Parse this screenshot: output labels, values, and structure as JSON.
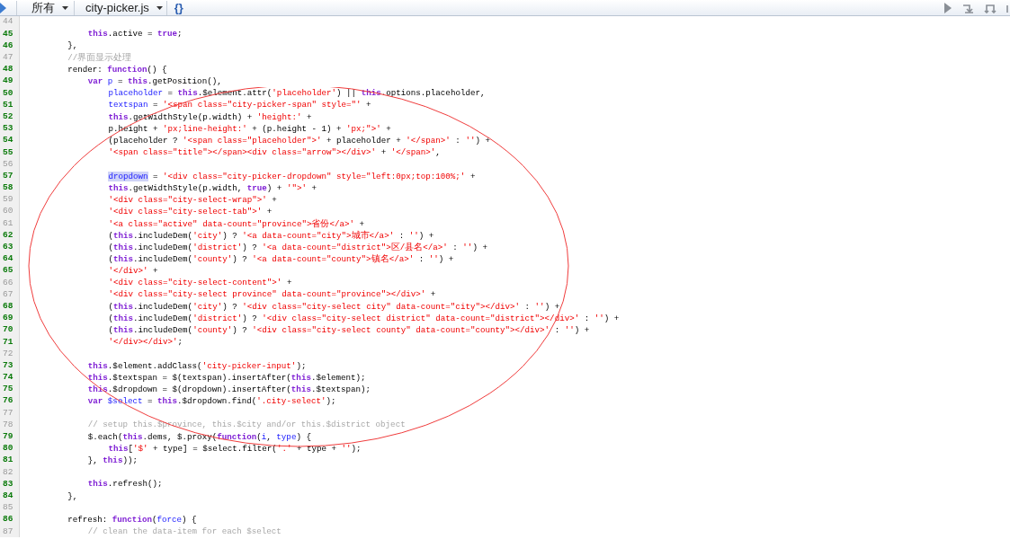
{
  "toolbar": {
    "scope": "所有",
    "file": "city-picker.js",
    "format_button": "{}"
  },
  "lines": [
    {
      "number": "44",
      "highlighted": false,
      "children": [
        {
          "number": "45",
          "highlighted": true,
          "tokens": [
            {
              "kind": "keyword",
              "text": "this"
            },
            {
              "kind": "plain",
              "text": ".active = "
            },
            {
              "kind": "keyword",
              "text": "true"
            },
            {
              "kind": "plain",
              "text": ";"
            }
          ]
        }
      ]
    },
    {
      "number": "46",
      "highlighted": true,
      "tokens": [
        {
          "kind": "plain",
          "text": "},"
        }
      ]
    },
    {
      "number": "47",
      "highlighted": false,
      "tokens": [
        {
          "kind": "comment",
          "text": "//界面显示处理"
        }
      ]
    },
    {
      "number": "48",
      "highlighted": true,
      "tokens": [
        {
          "kind": "plain",
          "text": "render: "
        },
        {
          "kind": "keyword",
          "text": "function"
        },
        {
          "kind": "plain",
          "text": "() {"
        }
      ],
      "children": [
        {
          "number": "49",
          "highlighted": true,
          "tokens": [
            {
              "kind": "keyword",
              "text": "var "
            },
            {
              "kind": "variable",
              "text": "p"
            },
            {
              "kind": "plain",
              "text": " = "
            },
            {
              "kind": "keyword",
              "text": "this"
            },
            {
              "kind": "plain",
              "text": ".getPosition(),"
            }
          ],
          "children": [
            {
              "number": "50",
              "highlighted": true,
              "tokens": [
                {
                  "kind": "variable",
                  "text": "placeholder"
                },
                {
                  "kind": "plain",
                  "text": " = "
                },
                {
                  "kind": "keyword",
                  "text": "this"
                },
                {
                  "kind": "plain",
                  "text": ".$element.attr("
                },
                {
                  "kind": "string",
                  "text": "'placeholder'"
                },
                {
                  "kind": "plain",
                  "text": ") || "
                },
                {
                  "kind": "keyword",
                  "text": "this"
                },
                {
                  "kind": "plain",
                  "text": ".options.placeholder,"
                }
              ]
            },
            {
              "number": "51",
              "highlighted": true,
              "tokens": [
                {
                  "kind": "variable",
                  "text": "textspan"
                },
                {
                  "kind": "plain",
                  "text": " = "
                },
                {
                  "kind": "string",
                  "text": "'<span class=\"city-picker-span\" style=\"'"
                },
                {
                  "kind": "plain",
                  "text": " +"
                }
              ]
            },
            {
              "number": "52",
              "highlighted": true,
              "tokens": [
                {
                  "kind": "keyword",
                  "text": "this"
                },
                {
                  "kind": "plain",
                  "text": ".getWidthStyle(p.width) + "
                },
                {
                  "kind": "string",
                  "text": "'height:'"
                },
                {
                  "kind": "plain",
                  "text": " +"
                }
              ]
            },
            {
              "number": "53",
              "highlighted": true,
              "tokens": [
                {
                  "kind": "plain",
                  "text": "p.height + "
                },
                {
                  "kind": "string",
                  "text": "'px;line-height:'"
                },
                {
                  "kind": "plain",
                  "text": " + (p.height - 1) + "
                },
                {
                  "kind": "string",
                  "text": "'px;\">'"
                },
                {
                  "kind": "plain",
                  "text": " +"
                }
              ]
            },
            {
              "number": "54",
              "highlighted": true,
              "tokens": [
                {
                  "kind": "plain",
                  "text": "(placeholder ? "
                },
                {
                  "kind": "string",
                  "text": "'<span class=\"placeholder\">'"
                },
                {
                  "kind": "plain",
                  "text": " + placeholder + "
                },
                {
                  "kind": "string",
                  "text": "'</span>'"
                },
                {
                  "kind": "plain",
                  "text": " : "
                },
                {
                  "kind": "string",
                  "text": "''"
                },
                {
                  "kind": "plain",
                  "text": ") +"
                }
              ]
            },
            {
              "number": "55",
              "highlighted": true,
              "tokens": [
                {
                  "kind": "string",
                  "text": "'<span class=\"title\"></span><div class=\"arrow\"></div>'"
                },
                {
                  "kind": "plain",
                  "text": " + "
                },
                {
                  "kind": "string",
                  "text": "'</span>'"
                },
                {
                  "kind": "plain",
                  "text": ","
                }
              ]
            },
            {
              "number": "56",
              "highlighted": false
            },
            {
              "number": "57",
              "highlighted": true,
              "tokens": [
                {
                  "kind": "match",
                  "text": "dropdown"
                },
                {
                  "kind": "plain",
                  "text": " = "
                },
                {
                  "kind": "string",
                  "text": "'<div class=\"city-picker-dropdown\" style=\"left:0px;top:100%;'"
                },
                {
                  "kind": "plain",
                  "text": " +"
                }
              ]
            },
            {
              "number": "58",
              "highlighted": true,
              "tokens": [
                {
                  "kind": "keyword",
                  "text": "this"
                },
                {
                  "kind": "plain",
                  "text": ".getWidthStyle(p.width, "
                },
                {
                  "kind": "keyword",
                  "text": "true"
                },
                {
                  "kind": "plain",
                  "text": ") + "
                },
                {
                  "kind": "string",
                  "text": "'\">'"
                },
                {
                  "kind": "plain",
                  "text": " +"
                }
              ]
            },
            {
              "number": "59",
              "highlighted": false,
              "tokens": [
                {
                  "kind": "string",
                  "text": "'<div class=\"city-select-wrap\">'"
                },
                {
                  "kind": "plain",
                  "text": " +"
                }
              ]
            },
            {
              "number": "60",
              "highlighted": false,
              "tokens": [
                {
                  "kind": "string",
                  "text": "'<div class=\"city-select-tab\">'"
                },
                {
                  "kind": "plain",
                  "text": " +"
                }
              ]
            },
            {
              "number": "61",
              "highlighted": false,
              "tokens": [
                {
                  "kind": "string",
                  "text": "'<a class=\"active\" data-count=\"province\">省份</a>'"
                },
                {
                  "kind": "plain",
                  "text": " +"
                }
              ]
            },
            {
              "number": "62",
              "highlighted": true,
              "tokens": [
                {
                  "kind": "plain",
                  "text": "("
                },
                {
                  "kind": "keyword",
                  "text": "this"
                },
                {
                  "kind": "plain",
                  "text": ".includeDem("
                },
                {
                  "kind": "string",
                  "text": "'city'"
                },
                {
                  "kind": "plain",
                  "text": ") ? "
                },
                {
                  "kind": "string",
                  "text": "'<a data-count=\"city\">城市</a>'"
                },
                {
                  "kind": "plain",
                  "text": " : "
                },
                {
                  "kind": "string",
                  "text": "''"
                },
                {
                  "kind": "plain",
                  "text": ") +"
                }
              ]
            },
            {
              "number": "63",
              "highlighted": true,
              "tokens": [
                {
                  "kind": "plain",
                  "text": "("
                },
                {
                  "kind": "keyword",
                  "text": "this"
                },
                {
                  "kind": "plain",
                  "text": ".includeDem("
                },
                {
                  "kind": "string",
                  "text": "'district'"
                },
                {
                  "kind": "plain",
                  "text": ") ? "
                },
                {
                  "kind": "string",
                  "text": "'<a data-count=\"district\">区/县名</a>'"
                },
                {
                  "kind": "plain",
                  "text": " : "
                },
                {
                  "kind": "string",
                  "text": "''"
                },
                {
                  "kind": "plain",
                  "text": ") +"
                }
              ]
            },
            {
              "number": "64",
              "highlighted": true,
              "tokens": [
                {
                  "kind": "plain",
                  "text": "("
                },
                {
                  "kind": "keyword",
                  "text": "this"
                },
                {
                  "kind": "plain",
                  "text": ".includeDem("
                },
                {
                  "kind": "string",
                  "text": "'county'"
                },
                {
                  "kind": "plain",
                  "text": ") ? "
                },
                {
                  "kind": "string",
                  "text": "'<a data-count=\"county\">镇名</a>'"
                },
                {
                  "kind": "plain",
                  "text": " : "
                },
                {
                  "kind": "string",
                  "text": "''"
                },
                {
                  "kind": "plain",
                  "text": ") +"
                }
              ]
            },
            {
              "number": "65",
              "highlighted": true,
              "tokens": [
                {
                  "kind": "string",
                  "text": "'</div>'"
                },
                {
                  "kind": "plain",
                  "text": " +"
                }
              ]
            },
            {
              "number": "66",
              "highlighted": false,
              "tokens": [
                {
                  "kind": "string",
                  "text": "'<div class=\"city-select-content\">'"
                },
                {
                  "kind": "plain",
                  "text": " +"
                }
              ]
            },
            {
              "number": "67",
              "highlighted": false,
              "tokens": [
                {
                  "kind": "string",
                  "text": "'<div class=\"city-select province\" data-count=\"province\"></div>'"
                },
                {
                  "kind": "plain",
                  "text": " +"
                }
              ]
            },
            {
              "number": "68",
              "highlighted": true,
              "tokens": [
                {
                  "kind": "plain",
                  "text": "("
                },
                {
                  "kind": "keyword",
                  "text": "this"
                },
                {
                  "kind": "plain",
                  "text": ".includeDem("
                },
                {
                  "kind": "string",
                  "text": "'city'"
                },
                {
                  "kind": "plain",
                  "text": ") ? "
                },
                {
                  "kind": "string",
                  "text": "'<div class=\"city-select city\" data-count=\"city\"></div>'"
                },
                {
                  "kind": "plain",
                  "text": " : "
                },
                {
                  "kind": "string",
                  "text": "''"
                },
                {
                  "kind": "plain",
                  "text": ") +"
                }
              ]
            },
            {
              "number": "69",
              "highlighted": true,
              "tokens": [
                {
                  "kind": "plain",
                  "text": "("
                },
                {
                  "kind": "keyword",
                  "text": "this"
                },
                {
                  "kind": "plain",
                  "text": ".includeDem("
                },
                {
                  "kind": "string",
                  "text": "'district'"
                },
                {
                  "kind": "plain",
                  "text": ") ? "
                },
                {
                  "kind": "string",
                  "text": "'<div class=\"city-select district\" data-count=\"district\"></div>'"
                },
                {
                  "kind": "plain",
                  "text": " : "
                },
                {
                  "kind": "string",
                  "text": "''"
                },
                {
                  "kind": "plain",
                  "text": ") +"
                }
              ]
            },
            {
              "number": "70",
              "highlighted": true,
              "tokens": [
                {
                  "kind": "plain",
                  "text": "("
                },
                {
                  "kind": "keyword",
                  "text": "this"
                },
                {
                  "kind": "plain",
                  "text": ".includeDem("
                },
                {
                  "kind": "string",
                  "text": "'county'"
                },
                {
                  "kind": "plain",
                  "text": ") ? "
                },
                {
                  "kind": "string",
                  "text": "'<div class=\"city-select county\" data-count=\"county\"></div>'"
                },
                {
                  "kind": "plain",
                  "text": " : "
                },
                {
                  "kind": "string",
                  "text": "''"
                },
                {
                  "kind": "plain",
                  "text": ") +"
                }
              ]
            },
            {
              "number": "71",
              "highlighted": true,
              "tokens": [
                {
                  "kind": "string",
                  "text": "'</div></div>'"
                },
                {
                  "kind": "plain",
                  "text": ";"
                }
              ]
            }
          ]
        },
        {
          "number": "72",
          "highlighted": false
        },
        {
          "number": "73",
          "highlighted": true,
          "tokens": [
            {
              "kind": "keyword",
              "text": "this"
            },
            {
              "kind": "plain",
              "text": ".$element.addClass("
            },
            {
              "kind": "string",
              "text": "'city-picker-input'"
            },
            {
              "kind": "plain",
              "text": ");"
            }
          ]
        },
        {
          "number": "74",
          "highlighted": true,
          "tokens": [
            {
              "kind": "keyword",
              "text": "this"
            },
            {
              "kind": "plain",
              "text": ".$textspan = $(textspan).insertAfter("
            },
            {
              "kind": "keyword",
              "text": "this"
            },
            {
              "kind": "plain",
              "text": ".$element);"
            }
          ]
        },
        {
          "number": "75",
          "highlighted": true,
          "tokens": [
            {
              "kind": "keyword",
              "text": "this"
            },
            {
              "kind": "plain",
              "text": ".$dropdown = $(dropdown).insertAfter("
            },
            {
              "kind": "keyword",
              "text": "this"
            },
            {
              "kind": "plain",
              "text": ".$textspan);"
            }
          ]
        },
        {
          "number": "76",
          "highlighted": true,
          "tokens": [
            {
              "kind": "keyword",
              "text": "var "
            },
            {
              "kind": "variable",
              "text": "$select"
            },
            {
              "kind": "plain",
              "text": " = "
            },
            {
              "kind": "keyword",
              "text": "this"
            },
            {
              "kind": "plain",
              "text": ".$dropdown.find("
            },
            {
              "kind": "string",
              "text": "'.city-select'"
            },
            {
              "kind": "plain",
              "text": ");"
            }
          ]
        },
        {
          "number": "77",
          "highlighted": false
        },
        {
          "number": "78",
          "highlighted": false,
          "tokens": [
            {
              "kind": "comment",
              "text": "// setup this.$province, this.$city and/or this.$district object"
            }
          ]
        },
        {
          "number": "79",
          "highlighted": true,
          "tokens": [
            {
              "kind": "plain",
              "text": "$.each("
            },
            {
              "kind": "keyword",
              "text": "this"
            },
            {
              "kind": "plain",
              "text": ".dems, $.proxy("
            },
            {
              "kind": "keyword",
              "text": "function"
            },
            {
              "kind": "plain",
              "text": "("
            },
            {
              "kind": "variable",
              "text": "i"
            },
            {
              "kind": "plain",
              "text": ", "
            },
            {
              "kind": "variable",
              "text": "type"
            },
            {
              "kind": "plain",
              "text": ") {"
            }
          ],
          "children": [
            {
              "number": "80",
              "highlighted": true,
              "tokens": [
                {
                  "kind": "keyword",
                  "text": "this"
                },
                {
                  "kind": "plain",
                  "text": "["
                },
                {
                  "kind": "string",
                  "text": "'$'"
                },
                {
                  "kind": "plain",
                  "text": " + type] = $select.filter("
                },
                {
                  "kind": "string",
                  "text": "'.'"
                },
                {
                  "kind": "plain",
                  "text": " + type + "
                },
                {
                  "kind": "string",
                  "text": "''"
                },
                {
                  "kind": "plain",
                  "text": ");"
                }
              ]
            }
          ]
        },
        {
          "number": "81",
          "highlighted": true,
          "tokens": [
            {
              "kind": "plain",
              "text": "}, "
            },
            {
              "kind": "keyword",
              "text": "this"
            },
            {
              "kind": "plain",
              "text": "));"
            }
          ]
        },
        {
          "number": "82",
          "highlighted": false
        },
        {
          "number": "83",
          "highlighted": true,
          "tokens": [
            {
              "kind": "keyword",
              "text": "this"
            },
            {
              "kind": "plain",
              "text": ".refresh();"
            }
          ]
        }
      ]
    },
    {
      "number": "84",
      "highlighted": true,
      "tokens": [
        {
          "kind": "plain",
          "text": "},"
        }
      ]
    },
    {
      "number": "85",
      "highlighted": false
    },
    {
      "number": "86",
      "highlighted": true,
      "tokens": [
        {
          "kind": "plain",
          "text": "refresh: "
        },
        {
          "kind": "keyword",
          "text": "function"
        },
        {
          "kind": "plain",
          "text": "("
        },
        {
          "kind": "variable",
          "text": "force"
        },
        {
          "kind": "plain",
          "text": ") {"
        }
      ],
      "children": [
        {
          "number": "87",
          "highlighted": false,
          "tokens": [
            {
              "kind": "comment",
              "text": "// clean the data-item for each $select"
            }
          ]
        }
      ]
    }
  ]
}
